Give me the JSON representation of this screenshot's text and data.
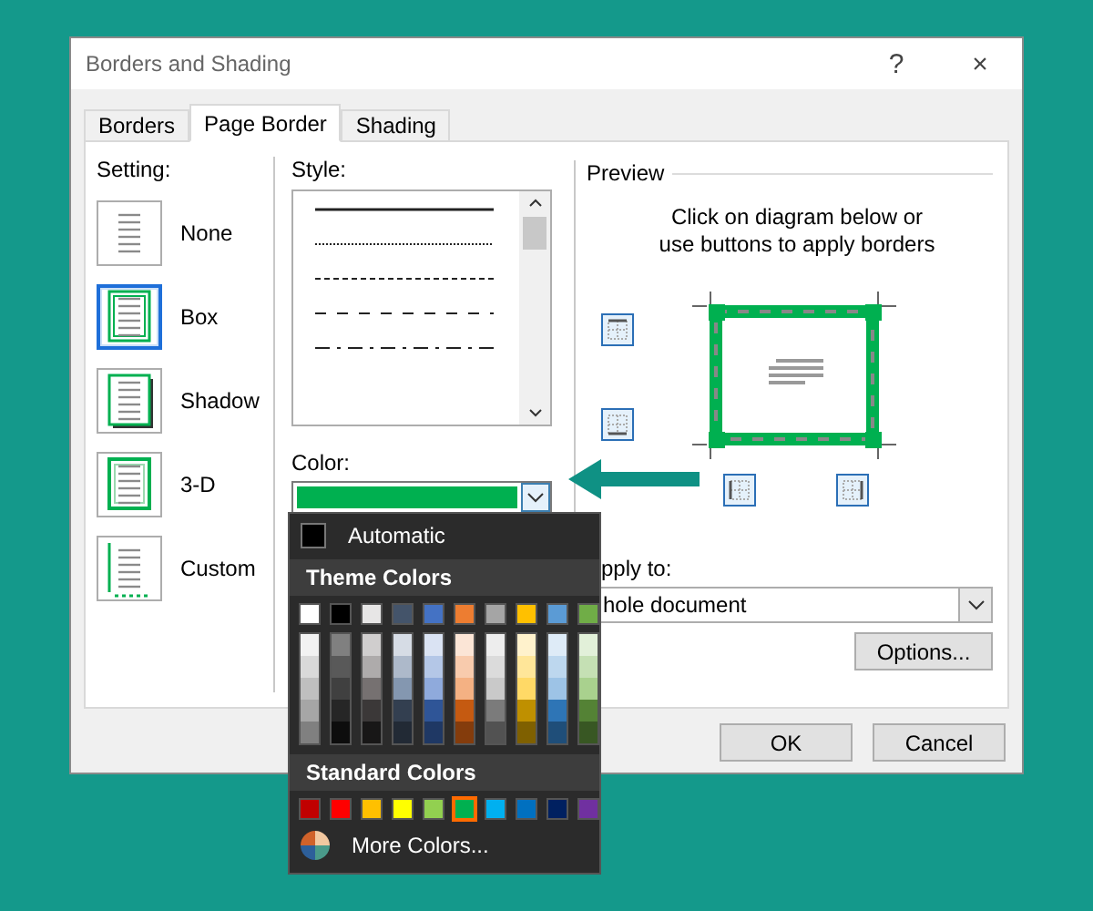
{
  "window": {
    "title": "Borders and Shading",
    "help": "?",
    "close": "×"
  },
  "tabs": [
    {
      "label": "Borders",
      "selected": false
    },
    {
      "label": "Page Border",
      "selected": true
    },
    {
      "label": "Shading",
      "selected": false
    }
  ],
  "setting": {
    "label": "Setting:",
    "items": [
      {
        "kind": "none",
        "label": "None",
        "selected": false
      },
      {
        "kind": "box",
        "label": "Box",
        "selected": true
      },
      {
        "kind": "shadow",
        "label": "Shadow",
        "selected": false
      },
      {
        "kind": "three-d",
        "label": "3-D",
        "selected": false
      },
      {
        "kind": "custom",
        "label": "Custom",
        "selected": false
      }
    ]
  },
  "style": {
    "label": "Style:",
    "lines": [
      {
        "kind": "solid"
      },
      {
        "kind": "dotted"
      },
      {
        "kind": "dashed"
      },
      {
        "kind": "wide-dashed"
      },
      {
        "kind": "dash-dot"
      }
    ]
  },
  "color": {
    "label": "Color:",
    "color": "#00b050"
  },
  "color_menu": {
    "automatic": "Automatic",
    "theme_header": "Theme Colors",
    "theme_colors": [
      {
        "color": "#ffffff",
        "shades": [
          {
            "color": "#f2f2f2"
          },
          {
            "color": "#d9d9d9"
          },
          {
            "color": "#bfbfbf"
          },
          {
            "color": "#a6a6a6"
          },
          {
            "color": "#808080"
          }
        ]
      },
      {
        "color": "#000000",
        "shades": [
          {
            "color": "#808080"
          },
          {
            "color": "#595959"
          },
          {
            "color": "#404040"
          },
          {
            "color": "#262626"
          },
          {
            "color": "#0d0d0d"
          }
        ]
      },
      {
        "color": "#e7e6e6",
        "shades": [
          {
            "color": "#d0cece"
          },
          {
            "color": "#aeabab"
          },
          {
            "color": "#767171"
          },
          {
            "color": "#3b3838"
          },
          {
            "color": "#181717"
          }
        ]
      },
      {
        "color": "#44546a",
        "shades": [
          {
            "color": "#d6dce5"
          },
          {
            "color": "#adb9ca"
          },
          {
            "color": "#8497b0"
          },
          {
            "color": "#333f50"
          },
          {
            "color": "#222a35"
          }
        ]
      },
      {
        "color": "#4472c4",
        "shades": [
          {
            "color": "#dae3f3"
          },
          {
            "color": "#b4c7e7"
          },
          {
            "color": "#8faadc"
          },
          {
            "color": "#2f5597"
          },
          {
            "color": "#1f3864"
          }
        ]
      },
      {
        "color": "#ed7d31",
        "shades": [
          {
            "color": "#fbe5d6"
          },
          {
            "color": "#f8cbad"
          },
          {
            "color": "#f4b183"
          },
          {
            "color": "#c55a11"
          },
          {
            "color": "#843c0c"
          }
        ]
      },
      {
        "color": "#a5a5a5",
        "shades": [
          {
            "color": "#ededed"
          },
          {
            "color": "#dbdbdb"
          },
          {
            "color": "#c9c9c9"
          },
          {
            "color": "#7b7b7b"
          },
          {
            "color": "#525252"
          }
        ]
      },
      {
        "color": "#ffc000",
        "shades": [
          {
            "color": "#fff2cc"
          },
          {
            "color": "#ffe699"
          },
          {
            "color": "#ffd966"
          },
          {
            "color": "#bf9000"
          },
          {
            "color": "#7f6000"
          }
        ]
      },
      {
        "color": "#5b9bd5",
        "shades": [
          {
            "color": "#deebf7"
          },
          {
            "color": "#bdd7ee"
          },
          {
            "color": "#9dc3e6"
          },
          {
            "color": "#2e75b6"
          },
          {
            "color": "#1f4e79"
          }
        ]
      },
      {
        "color": "#70ad47",
        "shades": [
          {
            "color": "#e2f0d9"
          },
          {
            "color": "#c5e0b4"
          },
          {
            "color": "#a9d18e"
          },
          {
            "color": "#548235"
          },
          {
            "color": "#385723"
          }
        ]
      }
    ],
    "standard_header": "Standard Colors",
    "standard_colors": [
      {
        "color": "#c00000",
        "selected": false
      },
      {
        "color": "#ff0000",
        "selected": false
      },
      {
        "color": "#ffc000",
        "selected": false
      },
      {
        "color": "#ffff00",
        "selected": false
      },
      {
        "color": "#92d050",
        "selected": false
      },
      {
        "color": "#00b050",
        "selected": true
      },
      {
        "color": "#00b0f0",
        "selected": false
      },
      {
        "color": "#0070c0",
        "selected": false
      },
      {
        "color": "#002060",
        "selected": false
      },
      {
        "color": "#7030a0",
        "selected": false
      }
    ],
    "more": "More Colors..."
  },
  "preview": {
    "label": "Preview",
    "instructions": "Click on diagram below or use buttons to apply borders",
    "apply_label": "pply to:",
    "apply_value": "hole document",
    "options": "Options..."
  },
  "buttons": [
    "OK",
    "Cancel"
  ]
}
